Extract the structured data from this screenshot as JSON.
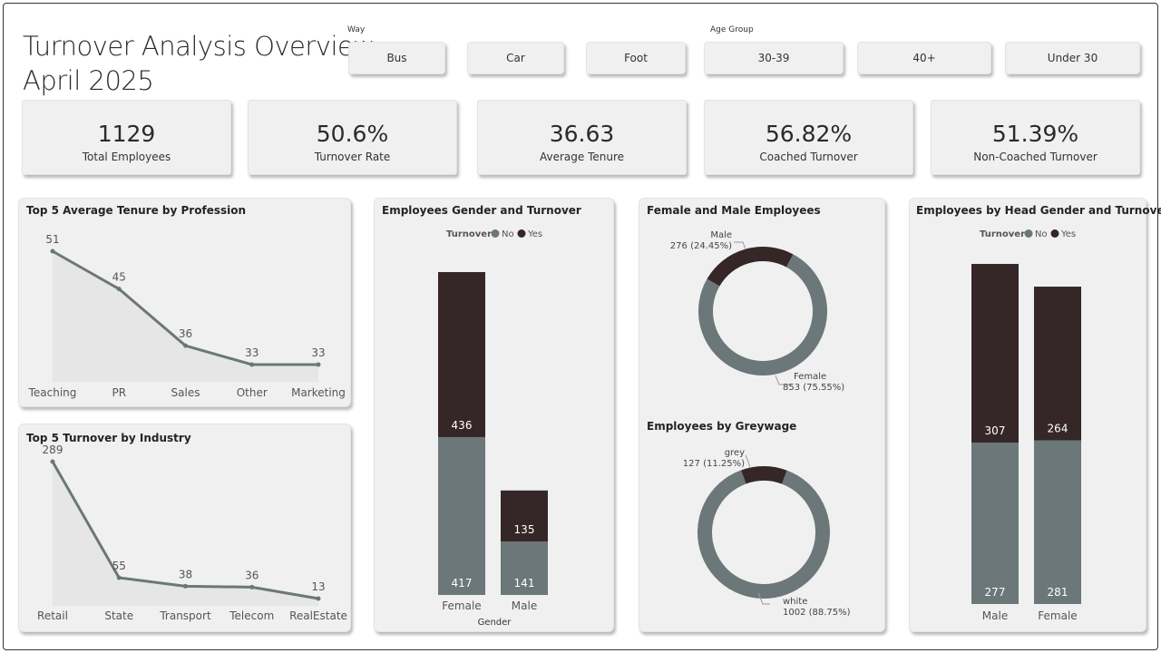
{
  "header": {
    "title_line1": "Turnover Analysis Overview",
    "title_line2": "April 2025"
  },
  "slicers": {
    "way": {
      "label": "Way",
      "options": [
        "Bus",
        "Car",
        "Foot"
      ]
    },
    "age_group": {
      "label": "Age Group",
      "options": [
        "30-39",
        "40+",
        "Under 30"
      ]
    }
  },
  "kpis": [
    {
      "value": "1129",
      "label": "Total Employees"
    },
    {
      "value": "50.6%",
      "label": "Turnover Rate"
    },
    {
      "value": "36.63",
      "label": "Average Tenure"
    },
    {
      "value": "56.82%",
      "label": "Coached Turnover"
    },
    {
      "value": "51.39%",
      "label": "Non-Coached Turnover"
    }
  ],
  "colors": {
    "no": "#6b7779",
    "yes": "#352728",
    "line": "#6b7779",
    "area": "#e6e6e6",
    "panel": "#f0f0f0"
  },
  "chart_data": [
    {
      "type": "area",
      "title": "Top 5 Average Tenure by Profession",
      "categories": [
        "Teaching",
        "PR",
        "Sales",
        "Other",
        "Marketing"
      ],
      "values": [
        51,
        45,
        36,
        33,
        33
      ]
    },
    {
      "type": "area",
      "title": "Top 5 Turnover by Industry",
      "categories": [
        "Retail",
        "State",
        "Transport",
        "Telecom",
        "RealEstate"
      ],
      "values": [
        289,
        55,
        38,
        36,
        13
      ]
    },
    {
      "type": "bar",
      "stacked": true,
      "title": "Employees Gender and Turnover",
      "legend_title": "Turnover",
      "xlabel": "Gender",
      "categories": [
        "Female",
        "Male"
      ],
      "series": [
        {
          "name": "No",
          "values": [
            417,
            141
          ]
        },
        {
          "name": "Yes",
          "values": [
            436,
            135
          ]
        }
      ]
    },
    {
      "type": "pie",
      "donut": true,
      "title": "Female and Male Employees",
      "slices": [
        {
          "label": "Male",
          "value": 276,
          "text": "276 (24.45%)"
        },
        {
          "label": "Female",
          "value": 853,
          "text": "853 (75.55%)"
        }
      ]
    },
    {
      "type": "pie",
      "donut": true,
      "title": "Employees by Greywage",
      "slices": [
        {
          "label": "grey",
          "value": 127,
          "text": "127 (11.25%)"
        },
        {
          "label": "white",
          "value": 1002,
          "text": "1002 (88.75%)"
        }
      ]
    },
    {
      "type": "bar",
      "stacked": true,
      "title": "Employees by Head Gender and Turnover",
      "legend_title": "Turnover",
      "categories": [
        "Male",
        "Female"
      ],
      "series": [
        {
          "name": "No",
          "values": [
            277,
            281
          ]
        },
        {
          "name": "Yes",
          "values": [
            307,
            264
          ]
        }
      ]
    }
  ]
}
